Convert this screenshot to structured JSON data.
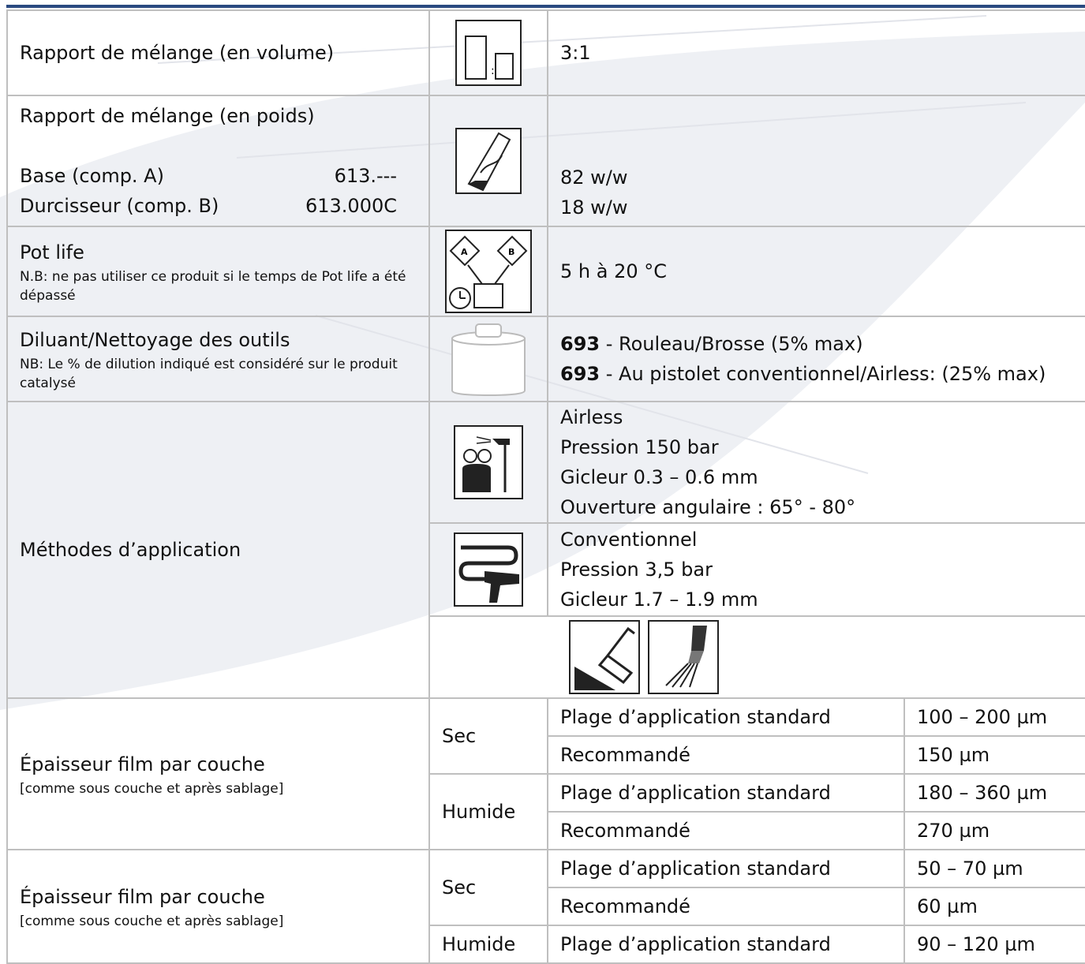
{
  "rows": {
    "mix_volume": {
      "label": "Rapport de mélange (en volume)",
      "value": "3:1",
      "icon": "volume-ratio-icon"
    },
    "mix_weight": {
      "label": "Rapport de mélange (en poids)",
      "base_label": "Base (comp. A)",
      "base_code": "613.---",
      "hardener_label": "Durcisseur (comp. B)",
      "hardener_code": "613.000C",
      "base_value": "82 w/w",
      "hardener_value": "18 w/w",
      "icon": "weight-ratio-icon"
    },
    "pot_life": {
      "label": "Pot life",
      "note": "N.B: ne pas utiliser ce produit si le temps de Pot life a été dépassé",
      "value": "5 h à 20 °C",
      "icon": "pot-life-icon"
    },
    "thinner": {
      "label": "Diluant/Nettoyage des outils",
      "note": "NB: Le % de dilution indiqué est considéré sur le produit catalysé",
      "line1_code": "693",
      "line1_text": " - Rouleau/Brosse (5% max)",
      "line2_code": "693",
      "line2_text": " - Au pistolet conventionnel/Airless: (25% max)",
      "icon": "thinner-can-icon"
    },
    "methods": {
      "label": "Méthodes d’application",
      "airless": [
        "Airless",
        "Pression 150 bar",
        "Gicleur 0.3 – 0.6 mm",
        "Ouverture angulaire : 65° - 80°"
      ],
      "conventional": [
        "Conventionnel",
        "Pression 3,5 bar",
        "Gicleur 1.7 – 1.9 mm"
      ],
      "icons": [
        "airless-spray-icon",
        "conventional-spray-icon",
        "roller-icon",
        "brush-icon"
      ]
    },
    "thickness1": {
      "label": "Épaisseur film par couche",
      "note": "[comme sous couche et après sablage]",
      "dry_label": "Sec",
      "wet_label": "Humide",
      "dry": [
        {
          "name": "Plage d’application standard",
          "value": "100 – 200 µm"
        },
        {
          "name": "Recommandé",
          "value": "150 µm"
        }
      ],
      "wet": [
        {
          "name": "Plage d’application standard",
          "value": "180 – 360 µm"
        },
        {
          "name": "Recommandé",
          "value": "270 µm"
        }
      ]
    },
    "thickness2": {
      "label": "Épaisseur film par couche",
      "note": "[comme sous couche et après sablage]",
      "dry_label": "Sec",
      "wet_label": "Humide",
      "dry": [
        {
          "name": "Plage d’application standard",
          "value": "50 – 70 µm"
        },
        {
          "name": "Recommandé",
          "value": "60 µm"
        }
      ],
      "wet": [
        {
          "name": "Plage d’application standard",
          "value": "90 – 120 µm"
        }
      ]
    }
  },
  "colors": {
    "accent": "#2a4a80",
    "grid": "#bfbfbf"
  }
}
